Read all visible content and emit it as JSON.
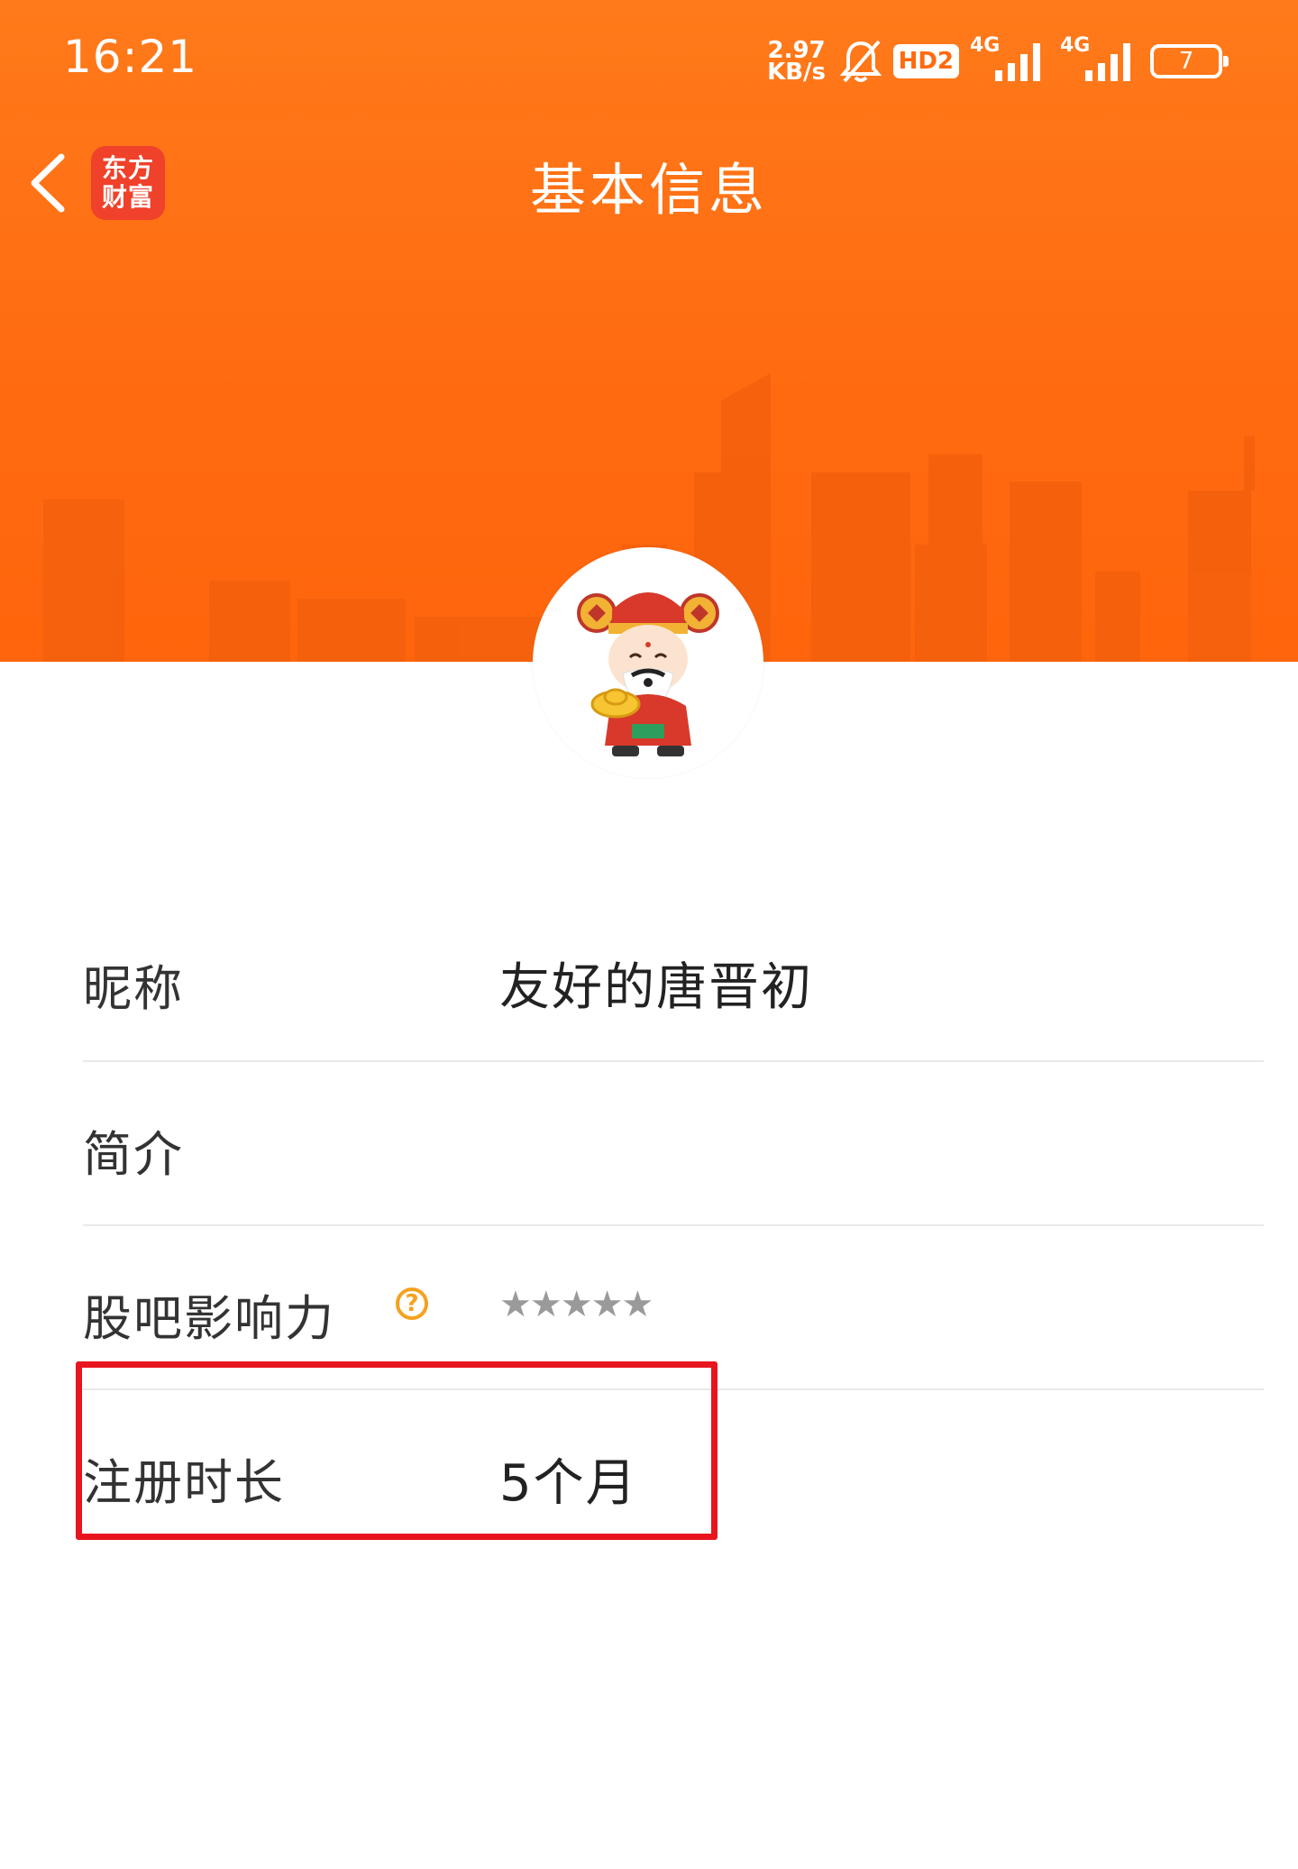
{
  "status_bar": {
    "time": "16:21",
    "net_speed_value": "2.97",
    "net_speed_unit": "KB/s",
    "hd_badge": "HD2",
    "signal_1_label": "4G",
    "signal_2_label": "4G",
    "battery_level": "7"
  },
  "nav": {
    "logo_line1": "东方",
    "logo_line2": "财富",
    "title": "基本信息"
  },
  "profile": {
    "rows": [
      {
        "label": "昵称",
        "value": "友好的唐晋初"
      },
      {
        "label": "简介",
        "value": ""
      },
      {
        "label": "股吧影响力",
        "help_icon": "?",
        "stars": "★★★★★",
        "rating": 0
      },
      {
        "label": "注册时长",
        "value": "5个月"
      }
    ]
  },
  "colors": {
    "banner": "#ff6a10",
    "highlight": "#e8141e",
    "help_icon": "#f5a21e",
    "logo_bg": "#f0412a"
  }
}
